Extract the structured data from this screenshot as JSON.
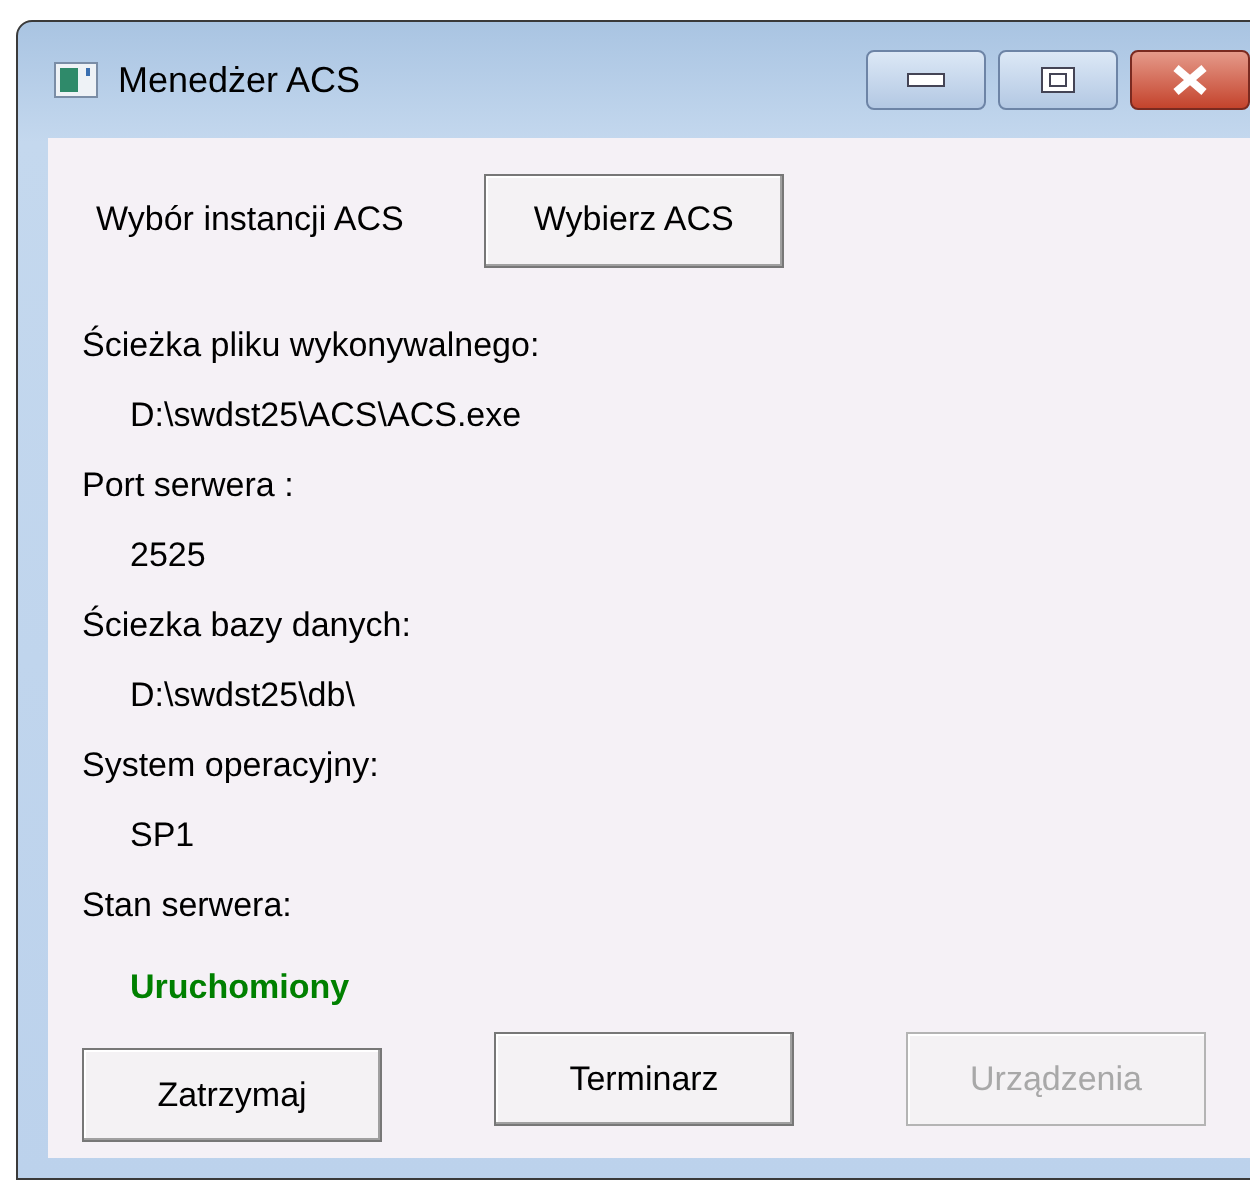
{
  "window": {
    "title": "Menedżer ACS"
  },
  "instance": {
    "label": "Wybór instancji ACS",
    "button": "Wybierz ACS"
  },
  "fields": [
    {
      "label": "Ścieżka pliku wykonywalnego:",
      "value": "D:\\swdst25\\ACS\\ACS.exe"
    },
    {
      "label": "Port serwera :",
      "value": "2525"
    },
    {
      "label": "Ściezka bazy danych:",
      "value": "D:\\swdst25\\db\\"
    },
    {
      "label": "System operacyjny:",
      "value": "SP1"
    }
  ],
  "status": {
    "label": "Stan serwera:",
    "value": "Uruchomiony",
    "color": "#008000"
  },
  "buttons": [
    {
      "label": "Zatrzymaj",
      "disabled": false
    },
    {
      "label": "Terminarz",
      "disabled": false
    },
    {
      "label": "Urządzenia",
      "disabled": true
    }
  ]
}
